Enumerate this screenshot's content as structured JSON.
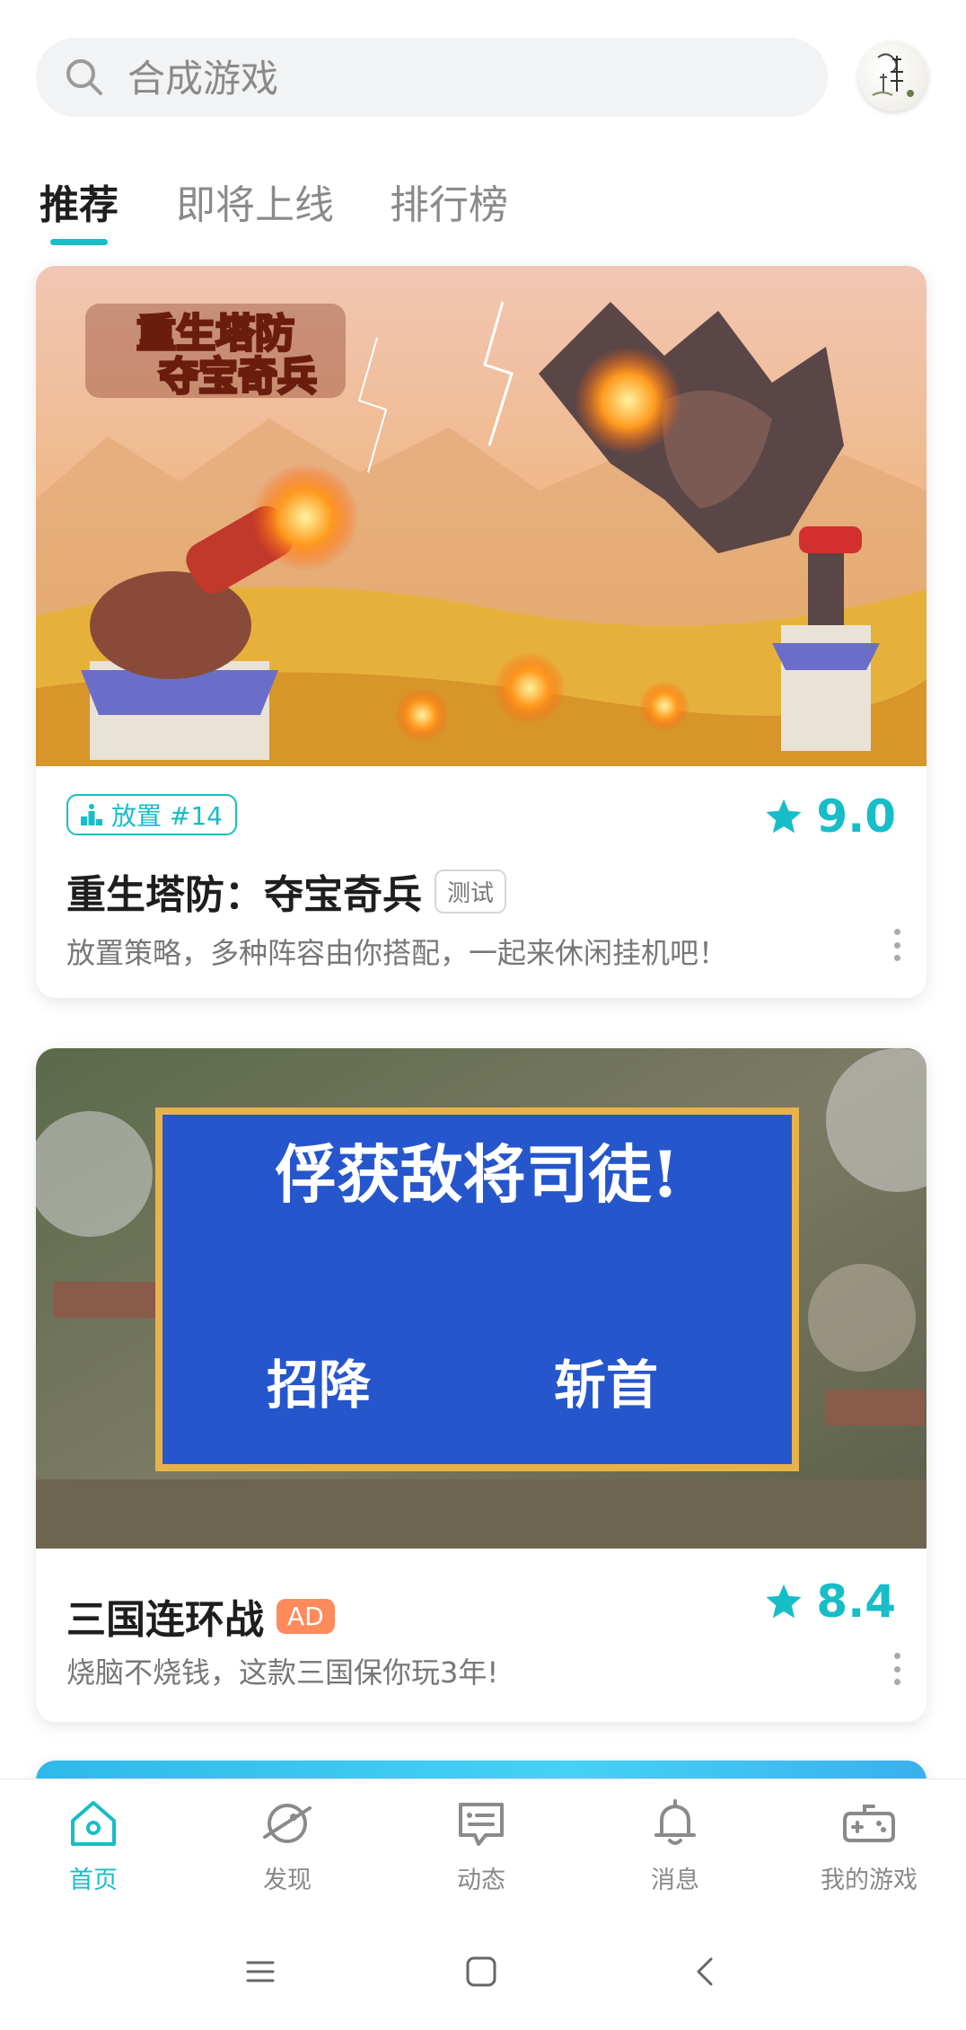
{
  "search": {
    "placeholder": "合成游戏"
  },
  "tabs": [
    {
      "label": "推荐",
      "active": true
    },
    {
      "label": "即将上线",
      "active": false
    },
    {
      "label": "排行榜",
      "active": false
    }
  ],
  "cards": [
    {
      "banner_logo_text": "重生塔防 夺宝奇兵",
      "tag": {
        "icon": "rank-podium-icon",
        "label": "放置 #14"
      },
      "rating": "9.0",
      "title": "重生塔防：夺宝奇兵",
      "badge": "测试",
      "description": "放置策略，多种阵容由你搭配，一起来休闲挂机吧！"
    },
    {
      "banner_headline": "俘获敌将司徒!",
      "banner_options": [
        "招降",
        "斩首"
      ],
      "rating": "8.4",
      "title": "三国连环战",
      "badge": "AD",
      "description": "烧脑不烧钱，这款三国保你玩3年!"
    }
  ],
  "bottom_nav": [
    {
      "label": "首页",
      "icon": "home-icon",
      "active": true
    },
    {
      "label": "发现",
      "icon": "planet-icon",
      "active": false
    },
    {
      "label": "动态",
      "icon": "chat-icon",
      "active": false
    },
    {
      "label": "消息",
      "icon": "bell-icon",
      "active": false
    },
    {
      "label": "我的游戏",
      "icon": "gamepad-icon",
      "active": false
    }
  ],
  "colors": {
    "accent": "#17bdc7",
    "ad_badge": "#ff8a5c"
  }
}
